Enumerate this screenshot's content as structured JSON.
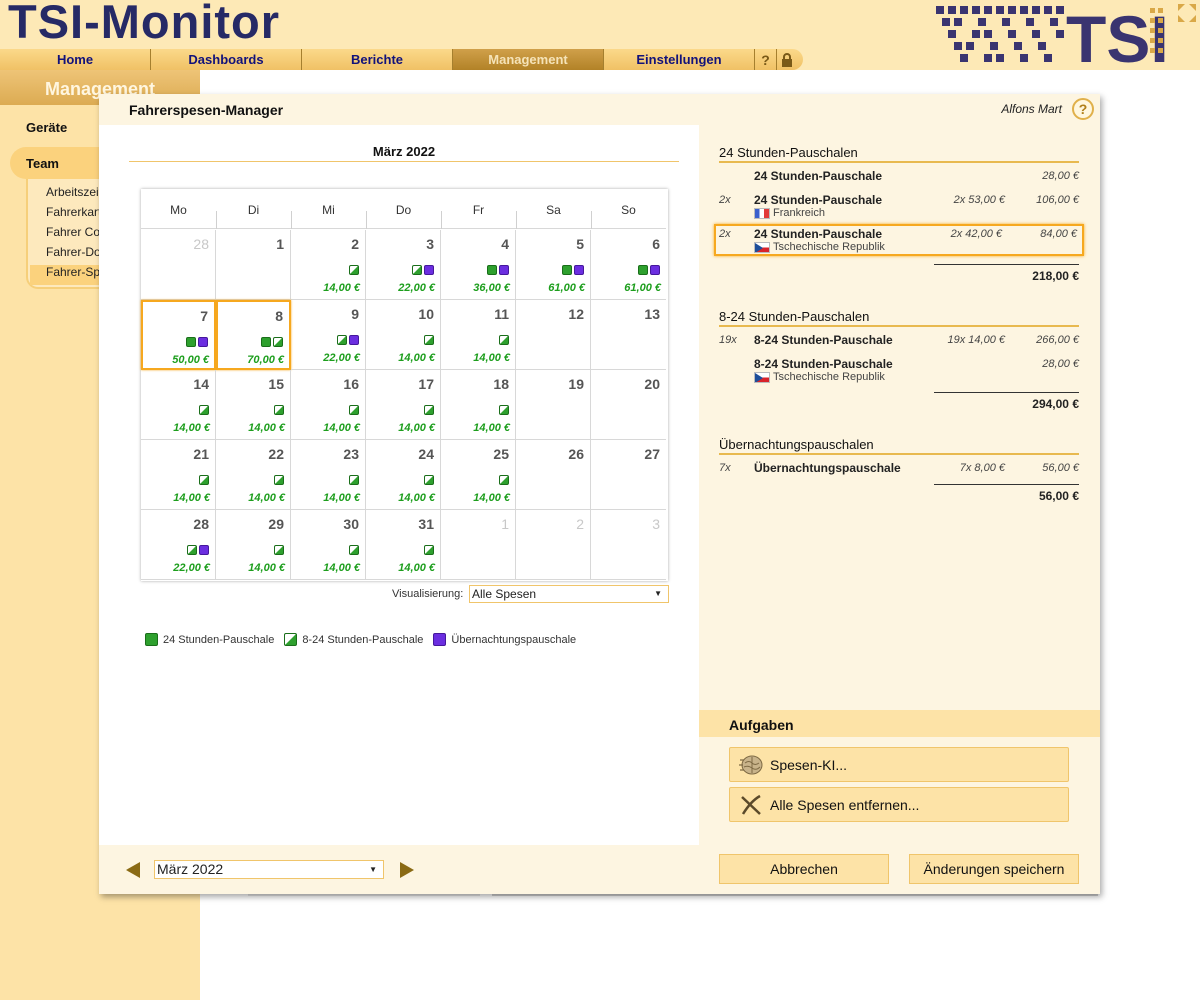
{
  "app": {
    "title": "TSI-Monitor",
    "logo_text": "TSI",
    "nav": [
      "Home",
      "Dashboards",
      "Berichte",
      "Management",
      "Einstellungen"
    ],
    "nav_active": 3
  },
  "sidebar": {
    "header": "Management",
    "items": [
      "Geräte",
      "Team"
    ],
    "sub_items": [
      "Arbeitszeit",
      "Fahrerkart",
      "Fahrer Co",
      "Fahrer-Do",
      "Fahrer-Sp"
    ]
  },
  "modal": {
    "title": "Fahrerspesen-Manager",
    "user": "Alfons Mart",
    "help": "?"
  },
  "calendar": {
    "month_title": "März 2022",
    "day_names": [
      "Mo",
      "Di",
      "Mi",
      "Do",
      "Fr",
      "Sa",
      "So"
    ],
    "cells": [
      {
        "day": "28",
        "other": true,
        "icons": [],
        "amount": ""
      },
      {
        "day": "1",
        "icons": [],
        "amount": ""
      },
      {
        "day": "2",
        "icons": [
          "half"
        ],
        "amount": "14,00 €"
      },
      {
        "day": "3",
        "icons": [
          "half",
          "purple"
        ],
        "amount": "22,00 €"
      },
      {
        "day": "4",
        "icons": [
          "green",
          "purple"
        ],
        "amount": "36,00 €"
      },
      {
        "day": "5",
        "icons": [
          "green",
          "purple"
        ],
        "amount": "61,00 €"
      },
      {
        "day": "6",
        "icons": [
          "green",
          "purple"
        ],
        "amount": "61,00 €"
      },
      {
        "day": "7",
        "selected": true,
        "icons": [
          "green",
          "purple"
        ],
        "amount": "50,00 €"
      },
      {
        "day": "8",
        "selected": true,
        "icons": [
          "green",
          "half"
        ],
        "amount": "70,00 €"
      },
      {
        "day": "9",
        "icons": [
          "half",
          "purple"
        ],
        "amount": "22,00 €"
      },
      {
        "day": "10",
        "icons": [
          "half"
        ],
        "amount": "14,00 €"
      },
      {
        "day": "11",
        "icons": [
          "half"
        ],
        "amount": "14,00 €"
      },
      {
        "day": "12",
        "icons": [],
        "amount": ""
      },
      {
        "day": "13",
        "icons": [],
        "amount": ""
      },
      {
        "day": "14",
        "icons": [
          "half"
        ],
        "amount": "14,00 €"
      },
      {
        "day": "15",
        "icons": [
          "half"
        ],
        "amount": "14,00 €"
      },
      {
        "day": "16",
        "icons": [
          "half"
        ],
        "amount": "14,00 €"
      },
      {
        "day": "17",
        "icons": [
          "half"
        ],
        "amount": "14,00 €"
      },
      {
        "day": "18",
        "icons": [
          "half"
        ],
        "amount": "14,00 €"
      },
      {
        "day": "19",
        "icons": [],
        "amount": ""
      },
      {
        "day": "20",
        "icons": [],
        "amount": ""
      },
      {
        "day": "21",
        "icons": [
          "half"
        ],
        "amount": "14,00 €"
      },
      {
        "day": "22",
        "icons": [
          "half"
        ],
        "amount": "14,00 €"
      },
      {
        "day": "23",
        "icons": [
          "half"
        ],
        "amount": "14,00 €"
      },
      {
        "day": "24",
        "icons": [
          "half"
        ],
        "amount": "14,00 €"
      },
      {
        "day": "25",
        "icons": [
          "half"
        ],
        "amount": "14,00 €"
      },
      {
        "day": "26",
        "icons": [],
        "amount": ""
      },
      {
        "day": "27",
        "icons": [],
        "amount": ""
      },
      {
        "day": "28",
        "icons": [
          "half",
          "purple"
        ],
        "amount": "22,00 €"
      },
      {
        "day": "29",
        "icons": [
          "half"
        ],
        "amount": "14,00 €"
      },
      {
        "day": "30",
        "icons": [
          "half"
        ],
        "amount": "14,00 €"
      },
      {
        "day": "31",
        "icons": [
          "half"
        ],
        "amount": "14,00 €"
      },
      {
        "day": "1",
        "other": true,
        "icons": [],
        "amount": ""
      },
      {
        "day": "2",
        "other": true,
        "icons": [],
        "amount": ""
      },
      {
        "day": "3",
        "other": true,
        "icons": [],
        "amount": ""
      }
    ],
    "visual_label": "Visualisierung:",
    "visual_value": "Alle Spesen",
    "legend": [
      {
        "icon": "green",
        "label": "24 Stunden-Pauschale"
      },
      {
        "icon": "half",
        "label": "8-24 Stunden-Pauschale"
      },
      {
        "icon": "purple",
        "label": "Übernachtungspauschale"
      }
    ]
  },
  "summary": {
    "sections": [
      {
        "title": "24 Stunden-Pauschalen",
        "rows": [
          {
            "count": "",
            "label": "24 Stunden-Pauschale",
            "country": "",
            "flag": "",
            "unit": "",
            "total": "28,00 €"
          },
          {
            "count": "2x",
            "label": "24 Stunden-Pauschale",
            "country": "Frankreich",
            "flag": "fr",
            "unit": "2x 53,00 €",
            "total": "106,00 €"
          },
          {
            "count": "2x",
            "label": "24 Stunden-Pauschale",
            "country": "Tschechische Republik",
            "flag": "cz",
            "unit": "2x 42,00 €",
            "total": "84,00 €",
            "highlight": true
          }
        ],
        "sum": "218,00 €"
      },
      {
        "title": "8-24 Stunden-Pauschalen",
        "rows": [
          {
            "count": "19x",
            "label": "8-24 Stunden-Pauschale",
            "country": "",
            "flag": "",
            "unit": "19x 14,00 €",
            "total": "266,00 €"
          },
          {
            "count": "",
            "label": "8-24 Stunden-Pauschale",
            "country": "Tschechische Republik",
            "flag": "cz",
            "unit": "",
            "total": "28,00 €"
          }
        ],
        "sum": "294,00 €"
      },
      {
        "title": "Übernachtungspauschalen",
        "rows": [
          {
            "count": "7x",
            "label": "Übernachtungspauschale",
            "country": "",
            "flag": "",
            "unit": "7x 8,00 €",
            "total": "56,00 €"
          }
        ],
        "sum": "56,00 €"
      }
    ]
  },
  "tasks": {
    "title": "Aufgaben",
    "buttons": [
      {
        "label": "Spesen-KI...",
        "icon": "brain-icon"
      },
      {
        "label": "Alle Spesen entfernen...",
        "icon": "remove-cross-icon"
      }
    ]
  },
  "footer": {
    "month": "März 2022",
    "cancel": "Abbrechen",
    "save": "Änderungen speichern"
  }
}
